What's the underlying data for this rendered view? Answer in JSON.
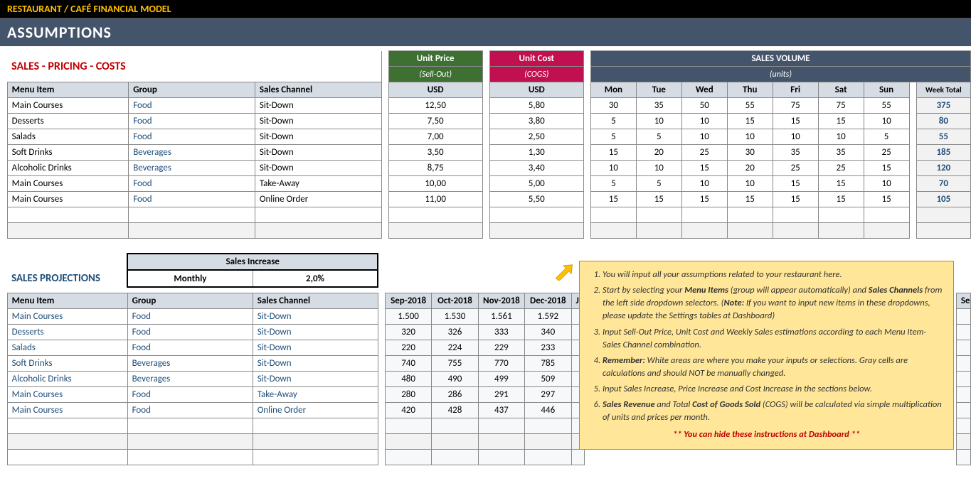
{
  "header": {
    "brand": "RESTAURANT / CAFÉ FINANCIAL MODEL",
    "title": "ASSUMPTIONS"
  },
  "section1": {
    "label": "SALES - PRICING - COSTS",
    "unit_price_h": "Unit Price",
    "unit_price_sub": "(Sell-Out)",
    "unit_cost_h": "Unit Cost",
    "unit_cost_sub": "(COGS)",
    "sales_vol_h": "SALES VOLUME",
    "sales_vol_sub": "(units)",
    "cols": {
      "menu": "Menu Item",
      "group": "Group",
      "channel": "Sales Channel",
      "usd1": "USD",
      "usd2": "USD",
      "mon": "Mon",
      "tue": "Tue",
      "wed": "Wed",
      "thu": "Thu",
      "fri": "Fri",
      "sat": "Sat",
      "sun": "Sun",
      "wt": "Week Total"
    },
    "rows": [
      {
        "menu": "Main Courses",
        "group": "Food",
        "channel": "Sit-Down",
        "up": "12,50",
        "uc": "5,80",
        "v": [
          "30",
          "35",
          "50",
          "55",
          "75",
          "75",
          "55"
        ],
        "wt": "375"
      },
      {
        "menu": "Desserts",
        "group": "Food",
        "channel": "Sit-Down",
        "up": "7,50",
        "uc": "3,80",
        "v": [
          "5",
          "10",
          "10",
          "15",
          "15",
          "15",
          "10"
        ],
        "wt": "80"
      },
      {
        "menu": "Salads",
        "group": "Food",
        "channel": "Sit-Down",
        "up": "7,00",
        "uc": "2,50",
        "v": [
          "5",
          "5",
          "10",
          "10",
          "10",
          "10",
          "5"
        ],
        "wt": "55"
      },
      {
        "menu": "Soft Drinks",
        "group": "Beverages",
        "channel": "Sit-Down",
        "up": "3,50",
        "uc": "1,30",
        "v": [
          "15",
          "20",
          "25",
          "30",
          "35",
          "35",
          "25"
        ],
        "wt": "185"
      },
      {
        "menu": "Alcoholic Drinks",
        "group": "Beverages",
        "channel": "Sit-Down",
        "up": "8,75",
        "uc": "3,40",
        "v": [
          "10",
          "10",
          "15",
          "20",
          "25",
          "25",
          "15"
        ],
        "wt": "120"
      },
      {
        "menu": "Main Courses",
        "group": "Food",
        "channel": "Take-Away",
        "up": "10,00",
        "uc": "5,00",
        "v": [
          "5",
          "5",
          "10",
          "10",
          "15",
          "15",
          "10"
        ],
        "wt": "70"
      },
      {
        "menu": "Main Courses",
        "group": "Food",
        "channel": "Online Order",
        "up": "11,00",
        "uc": "5,50",
        "v": [
          "15",
          "15",
          "15",
          "15",
          "15",
          "15",
          "15"
        ],
        "wt": "105"
      }
    ]
  },
  "sales_increase": {
    "header": "Sales Increase",
    "label": "Monthly",
    "value": "2,0%"
  },
  "section2": {
    "label": "SALES PROJECTIONS",
    "cols": {
      "menu": "Menu Item",
      "group": "Group",
      "channel": "Sales Channel"
    },
    "months": [
      "Sep-2018",
      "Oct-2018",
      "Nov-2018",
      "Dec-2018",
      "Ja",
      "Se"
    ],
    "rows": [
      {
        "menu": "Main Courses",
        "group": "Food",
        "channel": "Sit-Down",
        "v": [
          "1.500",
          "1.530",
          "1.561",
          "1.592"
        ]
      },
      {
        "menu": "Desserts",
        "group": "Food",
        "channel": "Sit-Down",
        "v": [
          "320",
          "326",
          "333",
          "340"
        ]
      },
      {
        "menu": "Salads",
        "group": "Food",
        "channel": "Sit-Down",
        "v": [
          "220",
          "224",
          "229",
          "233"
        ]
      },
      {
        "menu": "Soft Drinks",
        "group": "Beverages",
        "channel": "Sit-Down",
        "v": [
          "740",
          "755",
          "770",
          "785"
        ]
      },
      {
        "menu": "Alcoholic Drinks",
        "group": "Beverages",
        "channel": "Sit-Down",
        "v": [
          "480",
          "490",
          "499",
          "509"
        ]
      },
      {
        "menu": "Main Courses",
        "group": "Food",
        "channel": "Take-Away",
        "v": [
          "280",
          "286",
          "291",
          "297"
        ]
      },
      {
        "menu": "Main Courses",
        "group": "Food",
        "channel": "Online Order",
        "v": [
          "420",
          "428",
          "437",
          "446"
        ]
      }
    ]
  },
  "callout": {
    "i1": "You will input all your assumptions related to your restaurant here.",
    "i2a": "Start by selecting your ",
    "i2b": "Menu Items",
    "i2c": " (group will appear automatically) and ",
    "i2d": "Sales Channels",
    "i2e": " from the left side dropdown selectors. (",
    "i2f": "Note:",
    "i2g": " If you want to input new items in these dropdowns, please update the Settings tables at Dashboard)",
    "i3": "Input Sell-Out Price, Unit Cost and Weekly Sales estimations according to each Menu Item-Sales Channel combination.",
    "i4a": "Remember:",
    "i4b": " White areas are where you make your inputs or selections. Gray cells are calculations and should NOT be manually changed.",
    "i5": "Input Sales Increase, Price Increase and Cost Increase in the sections below.",
    "i6a": "Sales Revenue",
    "i6b": " and Total ",
    "i6c": "Cost of Goods Sold",
    "i6d": " (COGS) will be calculated via simple multiplication of units and prices per month.",
    "foot": "** You can hide these instructions at Dashboard **"
  }
}
